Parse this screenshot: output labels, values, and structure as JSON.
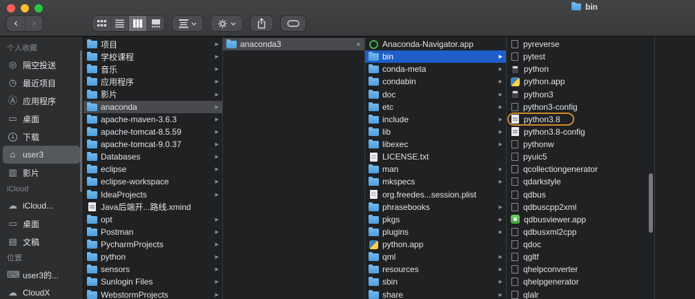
{
  "window": {
    "title": "bin"
  },
  "colors": {
    "accent_blue": "#1f5dc9",
    "selection_gray": "#47494c",
    "annotation_orange": "#d08c2a",
    "folder_blue": "#5aa7e8"
  },
  "annotation": {
    "target": "python3.8",
    "shape": "ellipse",
    "color": "#d08c2a"
  },
  "sidebar": {
    "sections": [
      {
        "label": "个人收藏",
        "items": [
          {
            "id": "airdrop",
            "label": "隔空投送",
            "icon": "airdrop",
            "selected": false
          },
          {
            "id": "recents",
            "label": "最近项目",
            "icon": "clock",
            "selected": false
          },
          {
            "id": "applications",
            "label": "应用程序",
            "icon": "applications",
            "selected": false
          },
          {
            "id": "desktop",
            "label": "桌面",
            "icon": "desktop",
            "selected": false
          },
          {
            "id": "downloads",
            "label": "下载",
            "icon": "download",
            "selected": false
          },
          {
            "id": "user3",
            "label": "user3",
            "icon": "home",
            "selected": true
          },
          {
            "id": "movies",
            "label": "影片",
            "icon": "movies",
            "selected": false
          }
        ]
      },
      {
        "label": "iCloud",
        "items": [
          {
            "id": "icloud-drive",
            "label": "iCloud...",
            "icon": "cloud",
            "selected": false
          },
          {
            "id": "icloud-desktop",
            "label": "桌面",
            "icon": "desktop",
            "selected": false
          },
          {
            "id": "icloud-documents",
            "label": "文稿",
            "icon": "documents",
            "selected": false
          }
        ]
      },
      {
        "label": "位置",
        "items": [
          {
            "id": "user3-mac",
            "label": "user3的...",
            "icon": "laptop",
            "selected": false
          },
          {
            "id": "cloudx",
            "label": "CloudX",
            "icon": "cloud",
            "selected": false
          }
        ]
      }
    ]
  },
  "columns": [
    {
      "scrollbar": false,
      "items": [
        {
          "label": "项目",
          "icon": "folder",
          "chevron": true
        },
        {
          "label": "学校课程",
          "icon": "folder",
          "chevron": true
        },
        {
          "label": "音乐",
          "icon": "folder",
          "chevron": true
        },
        {
          "label": "应用程序",
          "icon": "folder",
          "chevron": true
        },
        {
          "label": "影片",
          "icon": "folder",
          "chevron": true
        },
        {
          "label": "anaconda",
          "icon": "folder",
          "chevron": true,
          "selected": "gray"
        },
        {
          "label": "apache-maven-3.6.3",
          "icon": "folder",
          "chevron": true
        },
        {
          "label": "apache-tomcat-8.5.59",
          "icon": "folder",
          "chevron": true
        },
        {
          "label": "apache-tomcat-9.0.37",
          "icon": "folder",
          "chevron": true
        },
        {
          "label": "Databases",
          "icon": "folder",
          "chevron": true
        },
        {
          "label": "eclipse",
          "icon": "folder",
          "chevron": true
        },
        {
          "label": "eclipse-workspace",
          "icon": "folder",
          "chevron": true
        },
        {
          "label": "IdeaProjects",
          "icon": "folder",
          "chevron": true
        },
        {
          "label": "Java后端开...路线.xmind",
          "icon": "file",
          "chevron": false
        },
        {
          "label": "opt",
          "icon": "folder",
          "chevron": true
        },
        {
          "label": "Postman",
          "icon": "folder",
          "chevron": true
        },
        {
          "label": "PycharmProjects",
          "icon": "folder",
          "chevron": true
        },
        {
          "label": "python",
          "icon": "folder",
          "chevron": true
        },
        {
          "label": "sensors",
          "icon": "folder",
          "chevron": true
        },
        {
          "label": "Sunlogin Files",
          "icon": "folder",
          "chevron": true
        },
        {
          "label": "WebstormProjects",
          "icon": "folder",
          "chevron": true
        }
      ]
    },
    {
      "scrollbar": false,
      "items": [
        {
          "label": "anaconda3",
          "icon": "folder",
          "chevron": true,
          "selected": "gray"
        }
      ]
    },
    {
      "scrollbar": false,
      "items": [
        {
          "label": "Anaconda-Navigator.app",
          "icon": "app-anaconda",
          "chevron": false
        },
        {
          "label": "bin",
          "icon": "folder",
          "chevron": true,
          "selected": "blue"
        },
        {
          "label": "conda-meta",
          "icon": "folder",
          "chevron": true
        },
        {
          "label": "condabin",
          "icon": "folder",
          "chevron": true
        },
        {
          "label": "doc",
          "icon": "folder",
          "chevron": true
        },
        {
          "label": "etc",
          "icon": "folder",
          "chevron": true
        },
        {
          "label": "include",
          "icon": "folder",
          "chevron": true
        },
        {
          "label": "lib",
          "icon": "folder",
          "chevron": true
        },
        {
          "label": "libexec",
          "icon": "folder",
          "chevron": true
        },
        {
          "label": "LICENSE.txt",
          "icon": "file",
          "chevron": false
        },
        {
          "label": "man",
          "icon": "folder",
          "chevron": true
        },
        {
          "label": "mkspecs",
          "icon": "folder",
          "chevron": true
        },
        {
          "label": "org.freedes...session.plist",
          "icon": "file",
          "chevron": false
        },
        {
          "label": "phrasebooks",
          "icon": "folder",
          "chevron": true
        },
        {
          "label": "pkgs",
          "icon": "folder",
          "chevron": true
        },
        {
          "label": "plugins",
          "icon": "folder",
          "chevron": true
        },
        {
          "label": "python.app",
          "icon": "app-python",
          "chevron": false
        },
        {
          "label": "qml",
          "icon": "folder",
          "chevron": true
        },
        {
          "label": "resources",
          "icon": "folder",
          "chevron": true
        },
        {
          "label": "sbin",
          "icon": "folder",
          "chevron": true
        },
        {
          "label": "share",
          "icon": "folder",
          "chevron": true
        }
      ]
    },
    {
      "scrollbar": true,
      "items": [
        {
          "label": "pyreverse",
          "icon": "outline",
          "chevron": false
        },
        {
          "label": "pytest",
          "icon": "outline",
          "chevron": false
        },
        {
          "label": "python",
          "icon": "exec",
          "chevron": false
        },
        {
          "label": "python.app",
          "icon": "app-python",
          "chevron": false
        },
        {
          "label": "python3",
          "icon": "exec",
          "chevron": false
        },
        {
          "label": "python3-config",
          "icon": "outline",
          "chevron": false
        },
        {
          "label": "python3.8",
          "icon": "file",
          "chevron": false,
          "annotated": true
        },
        {
          "label": "python3.8-config",
          "icon": "file",
          "chevron": false
        },
        {
          "label": "pythonw",
          "icon": "outline",
          "chevron": false
        },
        {
          "label": "pyuic5",
          "icon": "outline",
          "chevron": false
        },
        {
          "label": "qcollectiongenerator",
          "icon": "outline",
          "chevron": false
        },
        {
          "label": "qdarkstyle",
          "icon": "outline",
          "chevron": false
        },
        {
          "label": "qdbus",
          "icon": "outline",
          "chevron": false
        },
        {
          "label": "qdbuscpp2xml",
          "icon": "outline",
          "chevron": false
        },
        {
          "label": "qdbusviewer.app",
          "icon": "app-green",
          "chevron": false
        },
        {
          "label": "qdbusxml2cpp",
          "icon": "outline",
          "chevron": false
        },
        {
          "label": "qdoc",
          "icon": "outline",
          "chevron": false
        },
        {
          "label": "qgltf",
          "icon": "outline",
          "chevron": false
        },
        {
          "label": "qhelpconverter",
          "icon": "outline",
          "chevron": false
        },
        {
          "label": "qhelpgenerator",
          "icon": "outline",
          "chevron": false
        },
        {
          "label": "qlalr",
          "icon": "outline",
          "chevron": false
        }
      ]
    }
  ]
}
